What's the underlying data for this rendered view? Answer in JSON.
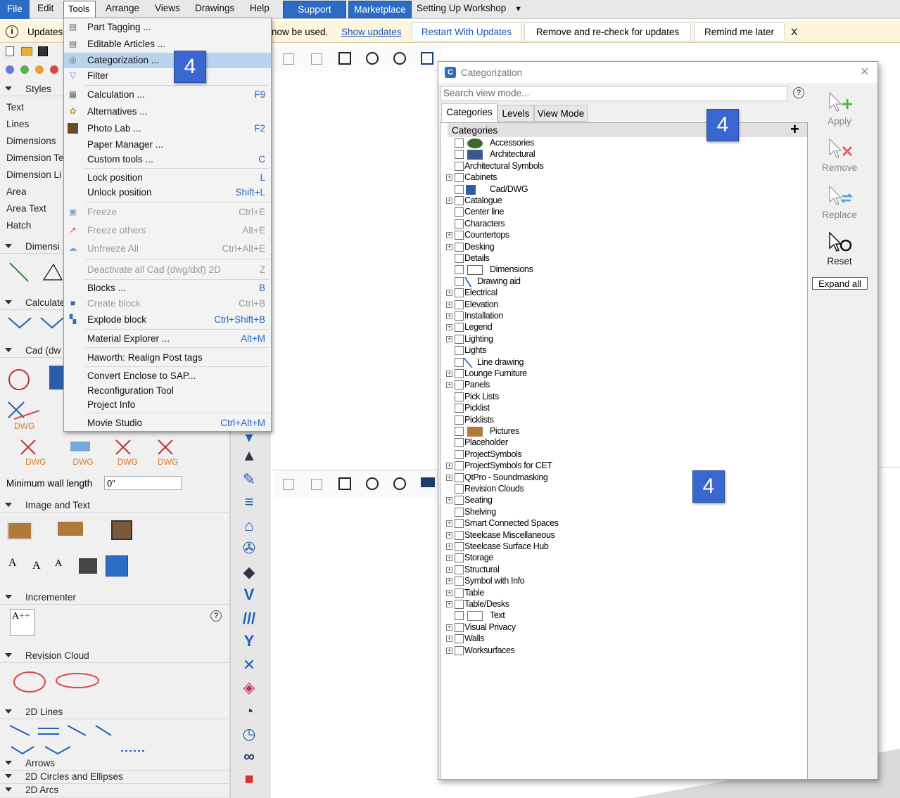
{
  "menubar": {
    "file": "File",
    "edit": "Edit",
    "tools": "Tools",
    "arrange": "Arrange",
    "views": "Views",
    "drawings": "Drawings",
    "help": "Help",
    "support": "Support",
    "marketplace": "Marketplace",
    "workshop": "Setting Up Workshop"
  },
  "updates": {
    "label": "Updates",
    "text": "now be used.",
    "show": "Show updates",
    "restart": "Restart With Updates",
    "remove": "Remove and re-check for updates",
    "remind": "Remind me later",
    "close": "X"
  },
  "left": {
    "styles": "Styles",
    "style_items": [
      "Text",
      "Lines",
      "Dimensions",
      "Dimension Te",
      "Dimension Li",
      "Area",
      "Area Text",
      "Hatch"
    ],
    "dimension": "Dimensi",
    "calculate": "Calculate",
    "cad": "Cad (dw",
    "dwg": "DWG",
    "min_wall_label": "Minimum wall length",
    "min_wall_value": "0\"",
    "image_text": "Image and Text",
    "incrementer": "Incrementer",
    "help": "?",
    "revision_cloud": "Revision Cloud",
    "lines2d": "2D Lines",
    "arrows": "Arrows",
    "circles": "2D Circles and Ellipses",
    "arcs": "2D Arcs"
  },
  "menu": {
    "items": [
      {
        "label": "Part Tagging ...",
        "sc": ""
      },
      {
        "label": "Editable Articles ...",
        "sc": ""
      },
      {
        "label": "Categorization ...",
        "sc": ""
      },
      {
        "label": "Filter",
        "sc": ""
      },
      {
        "label": "Calculation ...",
        "sc": "F9"
      },
      {
        "label": "Alternatives ...",
        "sc": ""
      },
      {
        "label": "Photo Lab ...",
        "sc": "F2"
      },
      {
        "label": "Paper Manager ...",
        "sc": ""
      },
      {
        "label": "Custom tools ...",
        "sc": "C"
      },
      {
        "label": "Lock position",
        "sc": "L"
      },
      {
        "label": "Unlock position",
        "sc": "Shift+L"
      },
      {
        "label": "Freeze",
        "sc": "Ctrl+E"
      },
      {
        "label": "Freeze others",
        "sc": "Alt+E"
      },
      {
        "label": "Unfreeze All",
        "sc": "Ctrl+Alt+E"
      },
      {
        "label": "Deactivate all Cad (dwg/dxf) 2D",
        "sc": "Z"
      },
      {
        "label": "Blocks ...",
        "sc": "B"
      },
      {
        "label": "Create block",
        "sc": "Ctrl+B"
      },
      {
        "label": "Explode block",
        "sc": "Ctrl+Shift+B"
      },
      {
        "label": "Material Explorer ...",
        "sc": "Alt+M"
      },
      {
        "label": "Haworth: Realign Post tags",
        "sc": ""
      },
      {
        "label": "Convert Enclose to SAP...",
        "sc": ""
      },
      {
        "label": "Reconfiguration Tool",
        "sc": ""
      },
      {
        "label": "Project Info",
        "sc": ""
      },
      {
        "label": "Movie Studio",
        "sc": "Ctrl+Alt+M"
      }
    ]
  },
  "badges": {
    "a": "4",
    "b": "4",
    "c": "4"
  },
  "dialog": {
    "title": "Categorization",
    "search_placeholder": "Search view mode...",
    "help": "?",
    "tabs": [
      "Categories",
      "Levels",
      "View Mode"
    ],
    "cat_header": "Categories",
    "plus": "+",
    "apply": "Apply",
    "remove": "Remove",
    "replace": "Replace",
    "reset": "Reset",
    "expand_all": "Expand all",
    "close": "×"
  },
  "categories": [
    {
      "label": "Accessories",
      "exp": false,
      "icon": "plant"
    },
    {
      "label": "Architectural",
      "exp": false,
      "icon": "arch"
    },
    {
      "label": "Architectural Symbols",
      "exp": false,
      "icon": ""
    },
    {
      "label": "Cabinets",
      "exp": true,
      "icon": ""
    },
    {
      "label": "Cad/DWG",
      "exp": false,
      "icon": "cad"
    },
    {
      "label": "Catalogue",
      "exp": true,
      "icon": ""
    },
    {
      "label": "Center line",
      "exp": false,
      "icon": ""
    },
    {
      "label": "Characters",
      "exp": false,
      "icon": ""
    },
    {
      "label": "Countertops",
      "exp": true,
      "icon": ""
    },
    {
      "label": "Desking",
      "exp": true,
      "icon": ""
    },
    {
      "label": "Details",
      "exp": false,
      "icon": ""
    },
    {
      "label": "Dimensions",
      "exp": false,
      "icon": "dim"
    },
    {
      "label": "Drawing aid",
      "exp": false,
      "icon": "aid"
    },
    {
      "label": "Electrical",
      "exp": true,
      "icon": ""
    },
    {
      "label": "Elevation",
      "exp": true,
      "icon": ""
    },
    {
      "label": "Installation",
      "exp": true,
      "icon": ""
    },
    {
      "label": "Legend",
      "exp": true,
      "icon": ""
    },
    {
      "label": "Lighting",
      "exp": true,
      "icon": ""
    },
    {
      "label": "Lights",
      "exp": false,
      "icon": ""
    },
    {
      "label": "Line drawing",
      "exp": false,
      "icon": "line"
    },
    {
      "label": "Lounge Furniture",
      "exp": true,
      "icon": ""
    },
    {
      "label": "Panels",
      "exp": true,
      "icon": ""
    },
    {
      "label": "Pick Lists",
      "exp": false,
      "icon": ""
    },
    {
      "label": "Picklist",
      "exp": false,
      "icon": ""
    },
    {
      "label": "Picklists",
      "exp": false,
      "icon": ""
    },
    {
      "label": "Pictures",
      "exp": false,
      "icon": "pic"
    },
    {
      "label": "Placeholder",
      "exp": false,
      "icon": ""
    },
    {
      "label": "ProjectSymbols",
      "exp": false,
      "icon": ""
    },
    {
      "label": "ProjectSymbols for CET",
      "exp": true,
      "icon": ""
    },
    {
      "label": "QtPro - Soundmasking",
      "exp": true,
      "icon": ""
    },
    {
      "label": "Revision Clouds",
      "exp": false,
      "icon": ""
    },
    {
      "label": "Seating",
      "exp": true,
      "icon": ""
    },
    {
      "label": "Shelving",
      "exp": false,
      "icon": ""
    },
    {
      "label": "Smart Connected Spaces",
      "exp": true,
      "icon": ""
    },
    {
      "label": "Steelcase Miscellaneous",
      "exp": true,
      "icon": ""
    },
    {
      "label": "Steelcase Surface Hub",
      "exp": true,
      "icon": ""
    },
    {
      "label": "Storage",
      "exp": true,
      "icon": ""
    },
    {
      "label": "Structural",
      "exp": true,
      "icon": ""
    },
    {
      "label": "Symbol with Info",
      "exp": true,
      "icon": ""
    },
    {
      "label": "Table",
      "exp": true,
      "icon": ""
    },
    {
      "label": "Table/Desks",
      "exp": true,
      "icon": ""
    },
    {
      "label": "Text",
      "exp": false,
      "icon": "text"
    },
    {
      "label": "Visual Privacy",
      "exp": true,
      "icon": ""
    },
    {
      "label": "Walls",
      "exp": true,
      "icon": ""
    },
    {
      "label": "Worksurfaces",
      "exp": true,
      "icon": ""
    }
  ],
  "canvas": {
    "plus": "+",
    "x": "×"
  },
  "colors": {
    "accent": "#2b6cc4",
    "badge": "#3a67cf",
    "link": "#2767c2"
  }
}
